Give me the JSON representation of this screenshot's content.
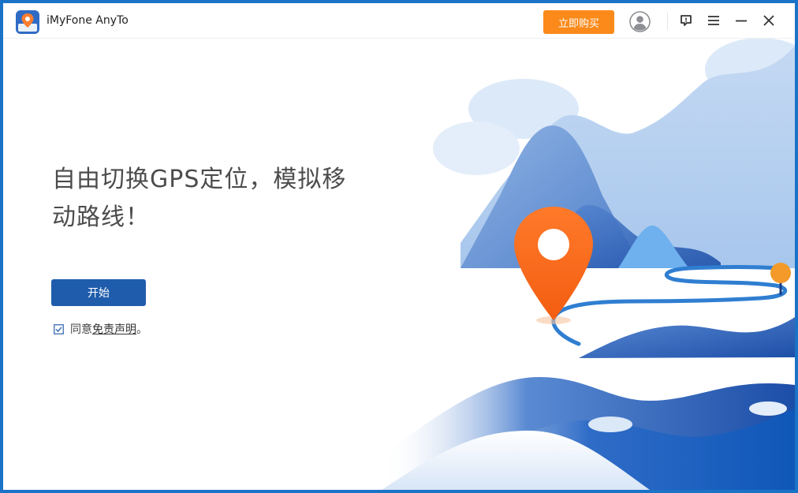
{
  "titlebar": {
    "app_title": "iMyFone AnyTo",
    "buy_label": "立即购买",
    "icons": [
      "app-logo",
      "user-avatar-icon",
      "feedback-icon",
      "menu-icon",
      "minimize-icon",
      "close-icon"
    ]
  },
  "main": {
    "headline_line1": "自由切换GPS定位，模拟移",
    "headline_line2": "动路线！",
    "start_label": "开始",
    "agree_prefix": "同意",
    "agree_link": "免责声明",
    "agree_suffix": "。",
    "agree_checked": true
  },
  "colors": {
    "accent_orange": "#fb8a1a",
    "primary_blue": "#1f5dac",
    "frame_blue": "#1a73c7"
  }
}
